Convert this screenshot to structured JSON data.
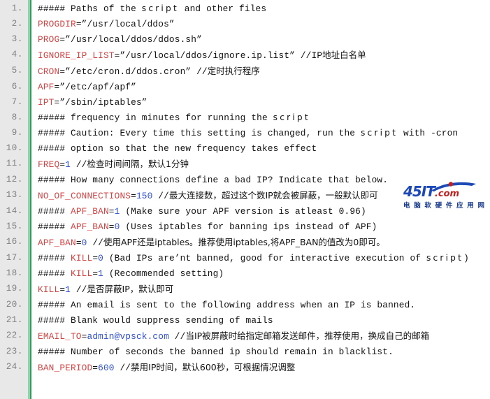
{
  "document": {
    "kind": "code-listing",
    "language": "shell",
    "gutter_color": "#e8e8e8",
    "rule_color": "#2e9e5b",
    "var_color": "#d34545",
    "num_color": "#2f4fd0",
    "text_color": "#111111"
  },
  "watermark": {
    "brand": "45IT",
    "tld": ".com",
    "subtitle": "电 脑 软 硬 件 应 用 网"
  },
  "lines": [
    {
      "no": "1.",
      "tokens": [
        {
          "t": "cmt",
          "v": "##### Paths of the "
        },
        {
          "t": "script",
          "v": "script"
        },
        {
          "t": "cmt",
          "v": " and other files"
        }
      ]
    },
    {
      "no": "2.",
      "tokens": [
        {
          "t": "var",
          "v": "PROGDIR"
        },
        {
          "t": "str",
          "v": "=”/usr/local/ddos”"
        }
      ]
    },
    {
      "no": "3.",
      "tokens": [
        {
          "t": "var",
          "v": "PROG"
        },
        {
          "t": "str",
          "v": "=”/usr/local/ddos/ddos.sh”"
        }
      ]
    },
    {
      "no": "4.",
      "tokens": [
        {
          "t": "var",
          "v": "IGNORE_IP_LIST"
        },
        {
          "t": "str",
          "v": "=”/usr/local/ddos/ignore.ip.list” "
        },
        {
          "t": "cmt",
          "v": "//IP"
        },
        {
          "t": "cn",
          "v": "地址白名单"
        }
      ]
    },
    {
      "no": "5.",
      "tokens": [
        {
          "t": "var",
          "v": "CRON"
        },
        {
          "t": "str",
          "v": "=”/etc/cron.d/ddos.cron” "
        },
        {
          "t": "cmt",
          "v": "//"
        },
        {
          "t": "cn",
          "v": "定时执行程序"
        }
      ]
    },
    {
      "no": "6.",
      "tokens": [
        {
          "t": "var",
          "v": "APF"
        },
        {
          "t": "str",
          "v": "=”/etc/apf/apf”"
        }
      ]
    },
    {
      "no": "7.",
      "tokens": [
        {
          "t": "var",
          "v": "IPT"
        },
        {
          "t": "str",
          "v": "=”/sbin/iptables”"
        }
      ]
    },
    {
      "no": "8.",
      "tokens": [
        {
          "t": "cmt",
          "v": "##### frequency in minutes for running the "
        },
        {
          "t": "script",
          "v": "script"
        }
      ]
    },
    {
      "no": "9.",
      "tokens": [
        {
          "t": "cmt",
          "v": "##### Caution: Every time this setting is changed, run the "
        },
        {
          "t": "script",
          "v": "script"
        },
        {
          "t": "cmt",
          "v": " with -cron"
        }
      ]
    },
    {
      "no": "10.",
      "tokens": [
        {
          "t": "cmt",
          "v": "##### option so that the new frequency takes effect"
        }
      ]
    },
    {
      "no": "11.",
      "tokens": [
        {
          "t": "var",
          "v": "FREQ"
        },
        {
          "t": "str",
          "v": "="
        },
        {
          "t": "num",
          "v": "1"
        },
        {
          "t": "cmt",
          "v": " //"
        },
        {
          "t": "cn",
          "v": "检查时间间隔，默认1分钟"
        }
      ]
    },
    {
      "no": "12.",
      "tokens": [
        {
          "t": "cmt",
          "v": "##### How many connections define a bad IP? Indicate that below."
        }
      ]
    },
    {
      "no": "13.",
      "tokens": [
        {
          "t": "var",
          "v": "NO_OF_CONNECTIONS"
        },
        {
          "t": "str",
          "v": "="
        },
        {
          "t": "num",
          "v": "150"
        },
        {
          "t": "cmt",
          "v": " //"
        },
        {
          "t": "cn",
          "v": "最大连接数，超过这个数IP就会被屏蔽，一般默认即可"
        }
      ]
    },
    {
      "no": "14.",
      "tokens": [
        {
          "t": "cmt",
          "v": "##### "
        },
        {
          "t": "var",
          "v": "APF_BAN"
        },
        {
          "t": "str",
          "v": "="
        },
        {
          "t": "num",
          "v": "1"
        },
        {
          "t": "cmt",
          "v": " (Make sure your APF version is atleast 0.96)"
        }
      ]
    },
    {
      "no": "15.",
      "tokens": [
        {
          "t": "cmt",
          "v": "##### "
        },
        {
          "t": "var",
          "v": "APF_BAN"
        },
        {
          "t": "str",
          "v": "="
        },
        {
          "t": "num",
          "v": "0"
        },
        {
          "t": "cmt",
          "v": " (Uses iptables for banning ips instead of APF)"
        }
      ]
    },
    {
      "no": "16.",
      "tokens": [
        {
          "t": "var",
          "v": "APF_BAN"
        },
        {
          "t": "str",
          "v": "="
        },
        {
          "t": "num",
          "v": "0"
        },
        {
          "t": "cmt",
          "v": " //"
        },
        {
          "t": "cn",
          "v": "使用APF还是iptables。推荐使用iptables,将APF_BAN的值改为0即可。"
        }
      ]
    },
    {
      "no": "17.",
      "tokens": [
        {
          "t": "cmt",
          "v": "##### "
        },
        {
          "t": "var",
          "v": "KILL"
        },
        {
          "t": "str",
          "v": "="
        },
        {
          "t": "num",
          "v": "0"
        },
        {
          "t": "cmt",
          "v": " (Bad IPs are’nt banned, good for interactive execution of "
        },
        {
          "t": "script",
          "v": "script"
        },
        {
          "t": "cmt",
          "v": ")"
        }
      ]
    },
    {
      "no": "18.",
      "tokens": [
        {
          "t": "cmt",
          "v": "##### "
        },
        {
          "t": "var",
          "v": "KILL"
        },
        {
          "t": "str",
          "v": "="
        },
        {
          "t": "num",
          "v": "1"
        },
        {
          "t": "cmt",
          "v": " (Recommended setting)"
        }
      ]
    },
    {
      "no": "19.",
      "tokens": [
        {
          "t": "var",
          "v": "KILL"
        },
        {
          "t": "str",
          "v": "="
        },
        {
          "t": "num",
          "v": "1"
        },
        {
          "t": "cmt",
          "v": " //"
        },
        {
          "t": "cn",
          "v": "是否屏蔽IP，默认即可"
        }
      ]
    },
    {
      "no": "20.",
      "tokens": [
        {
          "t": "cmt",
          "v": "##### An email is sent to the following address when an IP is banned."
        }
      ]
    },
    {
      "no": "21.",
      "tokens": [
        {
          "t": "cmt",
          "v": "##### Blank would suppress sending of mails"
        }
      ]
    },
    {
      "no": "22.",
      "tokens": [
        {
          "t": "var",
          "v": "EMAIL_TO"
        },
        {
          "t": "str",
          "v": "="
        },
        {
          "t": "num",
          "v": "admin@vpsck.com"
        },
        {
          "t": "cmt",
          "v": " //"
        },
        {
          "t": "cn",
          "v": "当IP被屏蔽时给指定邮箱发送邮件，推荐使用，换成自己的邮箱"
        }
      ]
    },
    {
      "no": "23.",
      "tokens": [
        {
          "t": "cmt",
          "v": "##### Number of seconds the banned ip should remain in blacklist."
        }
      ]
    },
    {
      "no": "24.",
      "tokens": [
        {
          "t": "var",
          "v": "BAN_PERIOD"
        },
        {
          "t": "str",
          "v": "="
        },
        {
          "t": "num",
          "v": "600"
        },
        {
          "t": "cmt",
          "v": " //"
        },
        {
          "t": "cn",
          "v": "禁用IP时间，默认600秒，可根据情况调整"
        }
      ]
    }
  ]
}
